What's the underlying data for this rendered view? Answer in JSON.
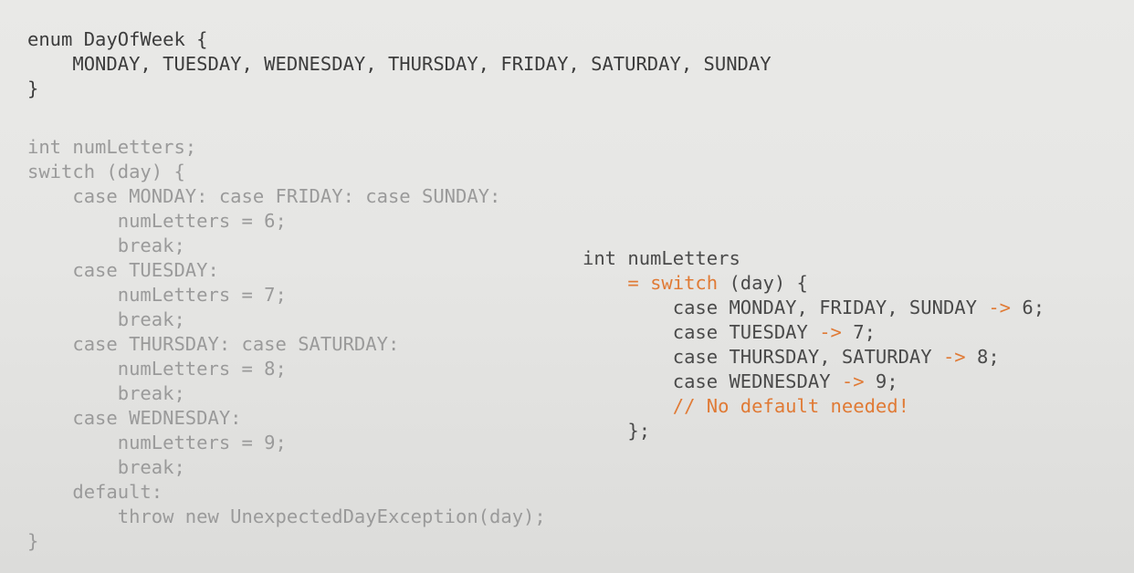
{
  "colors": {
    "background": "#e6e6e4",
    "primary_text": "#3c3c3c",
    "faded_text": "#9a9a9a",
    "accent": "#e07a35"
  },
  "enum_block": {
    "line1": "enum DayOfWeek {",
    "line2": "    MONDAY, TUESDAY, WEDNESDAY, THURSDAY, FRIDAY, SATURDAY, SUNDAY",
    "line3": "}"
  },
  "legacy_switch": {
    "lines": [
      "int numLetters;",
      "switch (day) {",
      "    case MONDAY: case FRIDAY: case SUNDAY:",
      "        numLetters = 6;",
      "        break;",
      "    case TUESDAY:",
      "        numLetters = 7;",
      "        break;",
      "    case THURSDAY: case SATURDAY:",
      "        numLetters = 8;",
      "        break;",
      "    case WEDNESDAY:",
      "        numLetters = 9;",
      "        break;",
      "    default:",
      "        throw new UnexpectedDayException(day);",
      "}"
    ]
  },
  "switch_expression": {
    "decl": "int numLetters",
    "assign_op": "= ",
    "switch_keyword": "switch",
    "switch_rest": " (day) {",
    "case1_head": "case MONDAY, FRIDAY, SUNDAY ",
    "case1_arrow": "->",
    "case1_tail": " 6;",
    "case2_head": "case TUESDAY ",
    "case2_arrow": "->",
    "case2_tail": " 7;",
    "case3_head": "case THURSDAY, SATURDAY ",
    "case3_arrow": "->",
    "case3_tail": " 8;",
    "case4_head": "case WEDNESDAY ",
    "case4_arrow": "->",
    "case4_tail": " 9;",
    "comment": "// No default needed!",
    "close": "};"
  }
}
